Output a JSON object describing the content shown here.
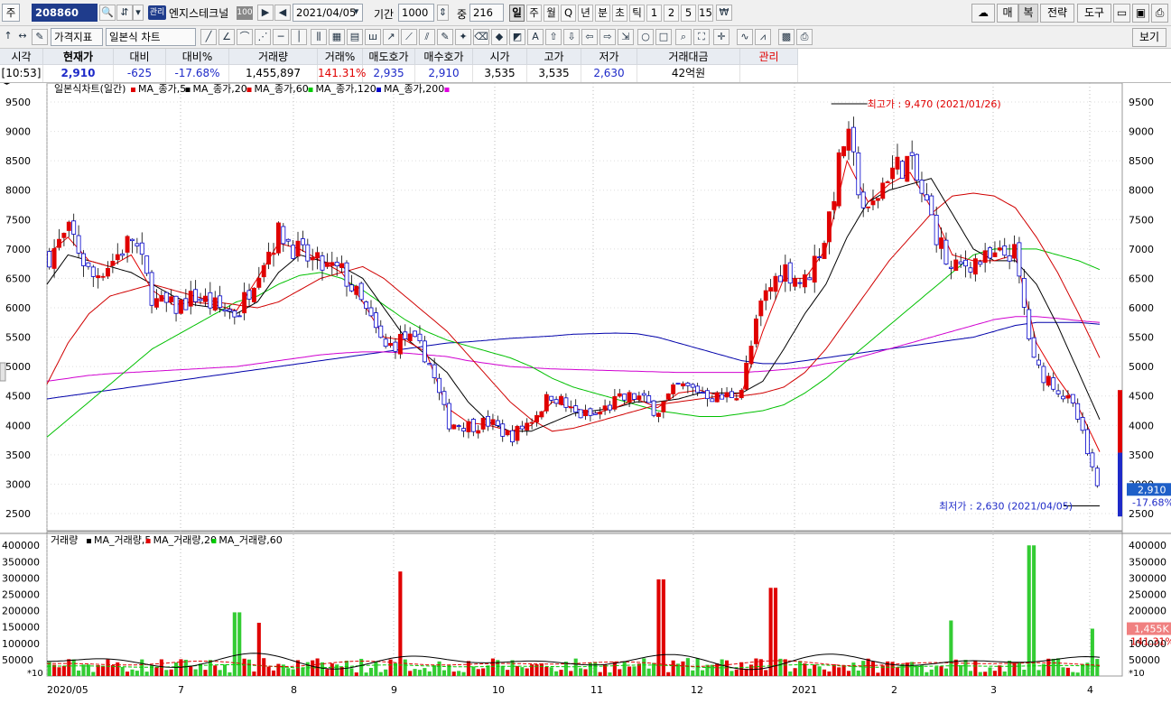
{
  "toolbar": {
    "market_label": "주",
    "code": "208860",
    "mgmt_badge": "관리",
    "stock_name": "엔지스테크널",
    "name_badge": "100",
    "date": "2021/04/05",
    "period_label": "기간",
    "period_value": "1000",
    "count_label": "중",
    "count_value": "216",
    "periods": [
      "일",
      "주",
      "월",
      "Q",
      "년",
      "분",
      "초",
      "틱",
      "1",
      "2",
      "5",
      "15"
    ],
    "selected_period": "일",
    "right_buttons": [
      "매",
      "복",
      "전략",
      "도구"
    ],
    "view_button": "보기"
  },
  "toolbar2": {
    "indicator_label": "가격지표",
    "chart_type": "일본식 차트"
  },
  "quote": {
    "headers": [
      "시각",
      "현재가",
      "대비",
      "대비%",
      "거래량",
      "거래%",
      "매도호가",
      "매수호가",
      "시가",
      "고가",
      "저가",
      "거래대금",
      "관리"
    ],
    "values": [
      "[10:53]",
      "2,910",
      "-625",
      "-17.68%",
      "1,455,897",
      "141.31%",
      "2,935",
      "2,910",
      "3,535",
      "3,535",
      "2,630",
      "42억원",
      ""
    ]
  },
  "price_panel": {
    "legend_title": "일본식차트(일간)",
    "legend_items": [
      {
        "label": "MA_종가,5",
        "color": "#e00000"
      },
      {
        "label": "MA_종가,20",
        "color": "#000000"
      },
      {
        "label": "MA_종가,60",
        "color": "#e00000"
      },
      {
        "label": "MA_종가,120",
        "color": "#00cc00"
      },
      {
        "label": "MA_종가,200",
        "color": "#0000cc"
      },
      {
        "label": "",
        "color": "#e000e0"
      }
    ],
    "y_ticks": [
      2500,
      3000,
      3500,
      4000,
      4500,
      5000,
      5500,
      6000,
      6500,
      7000,
      7500,
      8000,
      8500,
      9000,
      9500
    ],
    "max_annotation": "최고가 : 9,470 (2021/01/26)",
    "min_annotation": "최저가 : 2,630 (2021/04/05)",
    "current_price": "2,910",
    "current_change": "-17.68%"
  },
  "volume_panel": {
    "legend_title": "거래량",
    "legend_items": [
      {
        "label": "MA_거래량,5",
        "color": "#000000"
      },
      {
        "label": "MA_거래량,20",
        "color": "#e00000"
      },
      {
        "label": "MA_거래량,60",
        "color": "#00cc00"
      }
    ],
    "y_ticks": [
      "50000",
      "100000",
      "150000",
      "200000",
      "250000",
      "300000",
      "350000",
      "400000"
    ],
    "scale_label": "*10",
    "current_volume": "1,455K",
    "current_ratio": "141.31%"
  },
  "x_axis": {
    "labels": [
      "2020/05",
      "7",
      "8",
      "9",
      "10",
      "11",
      "12",
      "2021",
      "2",
      "3",
      "4"
    ]
  },
  "chart_data": {
    "type": "candlestick",
    "ylim": [
      2300,
      9700
    ],
    "key_points": {
      "max": {
        "date": "2021/01/26",
        "value": 9470
      },
      "min": {
        "date": "2021/04/05",
        "value": 2630
      }
    },
    "close_trend": [
      6900,
      7300,
      6500,
      6800,
      7200,
      6100,
      6000,
      6200,
      6000,
      5900,
      6700,
      7300,
      6900,
      6700,
      6600,
      6000,
      5300,
      5500,
      5200,
      4050,
      4000,
      4050,
      3800,
      4100,
      4550,
      4200,
      4150,
      4400,
      4500,
      4250,
      4650,
      4600,
      4450,
      4600,
      6100,
      6700,
      6400,
      7200,
      9000,
      7500,
      8300,
      8500,
      7600,
      6600,
      6800,
      6800,
      7000,
      5000,
      4700,
      4200,
      2910
    ],
    "ma5": [
      6900,
      7200,
      6800,
      6700,
      6900,
      6300,
      6050,
      6100,
      6050,
      5950,
      6500,
      7100,
      7000,
      6800,
      6600,
      6100,
      5500,
      5450,
      5250,
      4300,
      4050,
      4000,
      3900,
      4000,
      4400,
      4300,
      4200,
      4300,
      4450,
      4300,
      4550,
      4600,
      4500,
      4550,
      5600,
      6500,
      6500,
      7000,
      8500,
      7800,
      8100,
      8300,
      7700,
      6900,
      6800,
      6800,
      6900,
      5400,
      4800,
      4300,
      3550
    ],
    "ma20": [
      6400,
      6900,
      6800,
      6700,
      6600,
      6400,
      6200,
      6050,
      6000,
      5900,
      6100,
      6600,
      6900,
      6800,
      6700,
      6500,
      6000,
      5500,
      5200,
      4900,
      4400,
      4050,
      3900,
      3900,
      4050,
      4200,
      4250,
      4300,
      4400,
      4400,
      4450,
      4550,
      4550,
      4550,
      4750,
      5300,
      5900,
      6400,
      7200,
      7800,
      8000,
      8100,
      8200,
      7600,
      7000,
      6800,
      6800,
      6400,
      5700,
      4900,
      4100
    ],
    "ma60": [
      4700,
      5400,
      5900,
      6200,
      6300,
      6400,
      6300,
      6200,
      6100,
      6050,
      6000,
      6100,
      6300,
      6500,
      6600,
      6700,
      6500,
      6200,
      5900,
      5600,
      5200,
      4800,
      4400,
      4100,
      3900,
      3950,
      4050,
      4150,
      4250,
      4350,
      4400,
      4450,
      4500,
      4500,
      4550,
      4650,
      4900,
      5300,
      5800,
      6300,
      6800,
      7200,
      7600,
      7900,
      7950,
      7900,
      7700,
      7200,
      6600,
      5900,
      5150
    ],
    "ma120": [
      3800,
      4100,
      4400,
      4700,
      5000,
      5300,
      5500,
      5700,
      5900,
      6100,
      6200,
      6400,
      6550,
      6600,
      6500,
      6300,
      6050,
      5800,
      5600,
      5450,
      5350,
      5250,
      5150,
      5000,
      4800,
      4650,
      4550,
      4450,
      4350,
      4250,
      4200,
      4150,
      4150,
      4200,
      4250,
      4350,
      4550,
      4800,
      5100,
      5400,
      5700,
      6000,
      6300,
      6600,
      6900,
      7000,
      7000,
      7000,
      6900,
      6800,
      6650
    ],
    "ma200": [
      4450,
      4500,
      4550,
      4600,
      4650,
      4700,
      4750,
      4800,
      4850,
      4900,
      4950,
      5000,
      5050,
      5100,
      5150,
      5200,
      5250,
      5300,
      5350,
      5400,
      5420,
      5450,
      5480,
      5500,
      5520,
      5550,
      5560,
      5570,
      5560,
      5500,
      5400,
      5300,
      5200,
      5100,
      5050,
      5050,
      5100,
      5150,
      5200,
      5250,
      5300,
      5350,
      5400,
      5450,
      5500,
      5600,
      5700,
      5750,
      5750,
      5750,
      5720
    ],
    "ma_magenta": [
      4750,
      4800,
      4850,
      4880,
      4900,
      4920,
      4940,
      4960,
      4980,
      5000,
      5050,
      5100,
      5150,
      5200,
      5230,
      5250,
      5250,
      5230,
      5200,
      5170,
      5100,
      5050,
      5000,
      4980,
      4960,
      4950,
      4940,
      4930,
      4920,
      4910,
      4900,
      4900,
      4900,
      4900,
      4920,
      4950,
      4980,
      5050,
      5100,
      5200,
      5300,
      5400,
      5500,
      5600,
      5700,
      5800,
      5850,
      5850,
      5820,
      5780,
      5750
    ],
    "volume_peaks": [
      {
        "x": 0.18,
        "v": 195000
      },
      {
        "x": 0.2,
        "v": 163000
      },
      {
        "x": 0.335,
        "v": 320000
      },
      {
        "x": 0.585,
        "v": 296000
      },
      {
        "x": 0.69,
        "v": 270000
      },
      {
        "x": 0.86,
        "v": 170000
      },
      {
        "x": 0.937,
        "v": 400000
      },
      {
        "x": 0.995,
        "v": 145000
      }
    ]
  }
}
